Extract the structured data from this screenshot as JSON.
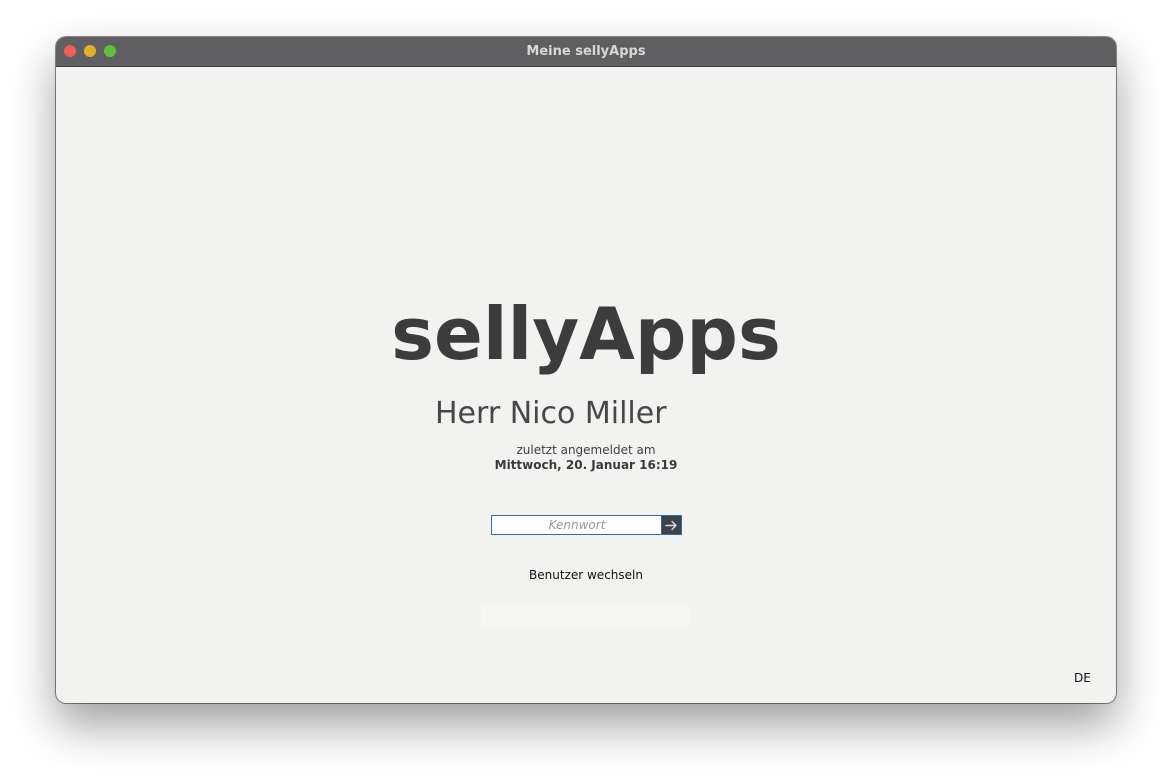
{
  "window": {
    "title": "Meine sellyApps"
  },
  "login": {
    "logo": "sellyApps",
    "user_name": "Herr Nico Miller",
    "last_login_label": "zuletzt angemeldet am",
    "last_login_date": "Mittwoch, 20. Januar 16:19",
    "password_value": "",
    "password_placeholder": "Kennwort",
    "submit_icon": "arrow-right-icon",
    "switch_user_label": "Benutzer wechseln"
  },
  "footer": {
    "language": "DE"
  },
  "colors": {
    "titlebar": "#5f5f62",
    "background": "#f2f2f1",
    "accent_border": "#2f6fa6",
    "submit_button": "#3d4149",
    "logo_text": "#3c3c3c"
  }
}
